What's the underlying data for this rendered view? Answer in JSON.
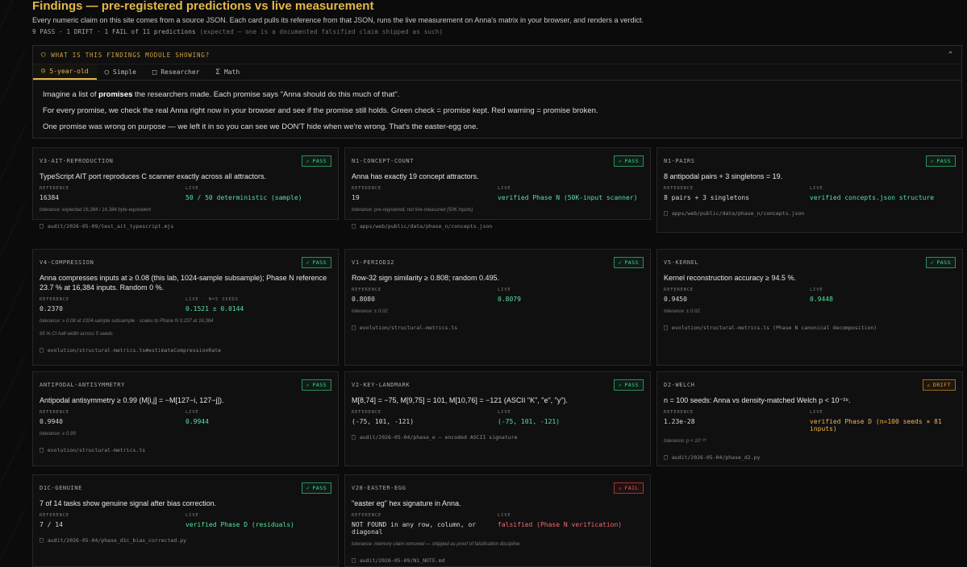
{
  "header": {
    "title": "Findings — pre-registered predictions vs live measurement",
    "subtitle": "Every numeric claim on this site comes from a source JSON. Each card pulls its reference from that JSON, runs the live measurement on Anna's matrix in your browser, and renders a verdict.",
    "stats": "9 PASS · 1 DRIFT · 1 FAIL of 11 predictions",
    "stats_note": "(expected — one is a documented falsified claim shipped as such)"
  },
  "explainer": {
    "heading": "WHAT IS THIS FINDINGS MODULE SHOWING?",
    "tabs": [
      "5-year-old",
      "Simple",
      "Researcher",
      "Math"
    ],
    "active_tab": "5-year-old",
    "p1_a": "Imagine a list of ",
    "p1_b": "promises",
    "p1_c": " the researchers made. Each promise says \"Anna should do this much of that\".",
    "p2": "For every promise, we check the real Anna right now in your browser and see if the promise still holds. Green check = promise kept. Red warning = promise broken.",
    "p3": "One promise was wrong on purpose — we left it in so you can see we DON'T hide when we're wrong. That's the easter-egg one."
  },
  "labels": {
    "reference": "REFERENCE",
    "live": "LIVE"
  },
  "cards": [
    {
      "id": "V3-AIT-REPRODUCTION",
      "status": "PASS",
      "claim": "TypeScript AIT port reproduces C scanner exactly across all attractors.",
      "reference": "16384",
      "live_label": "LIVE",
      "live": "50 / 50 deterministic (sample)",
      "notes": [
        "tolerance: expected 16,384 / 16,384 byte-equivalent"
      ],
      "source": "audit/2026-05-09/test_ait_typescript.mjs"
    },
    {
      "id": "N1-CONCEPT-COUNT",
      "status": "PASS",
      "claim": "Anna has exactly 19 concept attractors.",
      "reference": "19",
      "live_label": "LIVE",
      "live": "verified Phase N (50K-input scanner)",
      "notes": [
        "tolerance: pre-registered, not live-measured (50K inputs)"
      ],
      "source": "apps/web/public/data/phase_n/concepts.json"
    },
    {
      "id": "N1-PAIRS",
      "status": "PASS",
      "claim": "8 antipodal pairs + 3 singletons = 19.",
      "reference": "8 pairs + 3 singletons",
      "live_label": "LIVE",
      "live": "verified concepts.json structure",
      "notes": [],
      "source": "apps/web/public/data/phase_n/concepts.json"
    },
    {
      "id": "V4-COMPRESSION",
      "status": "PASS",
      "claim": "Anna compresses inputs at ≥ 0.08 (this lab, 1024-sample subsample); Phase N reference 23.7 % at 16,384 inputs. Random 0 %.",
      "reference": "0.2370",
      "live_label": "LIVE · N=5 SEEDS",
      "live": "0.1521 ± 0.0144",
      "notes": [
        "tolerance: ≥ 0.08 at 1024-sample subsample · scales to Phase N 0.237 at 16,384",
        "95 % CI half-width across 5 seeds"
      ],
      "source": "evolution/structural-metrics.ts#estimateCompressionRate"
    },
    {
      "id": "V1-PERIOD32",
      "status": "PASS",
      "claim": "Row-32 sign similarity ≥ 0.808; random 0.495.",
      "reference": "0.8080",
      "live_label": "LIVE",
      "live": "0.8079",
      "notes": [
        "tolerance: ± 0.02"
      ],
      "source": "evolution/structural-metrics.ts"
    },
    {
      "id": "V5-KERNEL",
      "status": "PASS",
      "claim": "Kernel reconstruction accuracy ≥ 94.5 %.",
      "reference": "0.9450",
      "live_label": "LIVE",
      "live": "0.9448",
      "notes": [
        "tolerance: ± 0.02"
      ],
      "source": "evolution/structural-metrics.ts (Phase N canonical decomposition)"
    },
    {
      "id": "ANTIPODAL-ANTISYMMETRY",
      "status": "PASS",
      "claim": "Antipodal antisymmetry ≥ 0.99 (M[i,j] = −M[127−i, 127−j]).",
      "reference": "0.9940",
      "live_label": "LIVE",
      "live": "0.9944",
      "notes": [
        "tolerance: ≥ 0.99"
      ],
      "source": "evolution/structural-metrics.ts"
    },
    {
      "id": "V2-KEY-LANDMARK",
      "status": "PASS",
      "claim": "M[8,74] = −75, M[9,75] = 101, M[10,76] = −121 (ASCII \"K\", \"e\", \"y\").",
      "reference": "(-75, 101, -121)",
      "live_label": "LIVE",
      "live": "(-75, 101, -121)",
      "notes": [],
      "source": "audit/2026-05-04/phase_e — encoded ASCII signature"
    },
    {
      "id": "D2-WELCH",
      "status": "DRIFT",
      "claim": "n = 100 seeds: Anna vs density-matched Welch p < 10⁻²⁸.",
      "reference": "1.23e-28",
      "live_label": "LIVE",
      "live": "verified Phase D (n=100 seeds × 81 inputs)",
      "notes": [
        "tolerance: p < 10⁻²⁸"
      ],
      "source": "audit/2026-05-04/phase_d2.py"
    },
    {
      "id": "D1C-GENUINE",
      "status": "PASS",
      "claim": "7 of 14 tasks show genuine signal after bias correction.",
      "reference": "7 / 14",
      "live_label": "LIVE",
      "live": "verified Phase D (residuals)",
      "notes": [],
      "source": "audit/2026-05-04/phase_d1c_bias_corrected.py"
    },
    {
      "id": "V28-EASTER-EGG",
      "status": "FAIL",
      "claim": "\"easter eg\" hex signature in Anna.",
      "reference": "NOT FOUND in any row, column, or diagonal",
      "live_label": "LIVE",
      "live": "falsified (Phase N verification)",
      "notes": [
        "tolerance: memory claim removed — shipped as proof of falsification discipline"
      ],
      "source": "audit/2026-05-09/N1_NOTE.md"
    }
  ],
  "colors": {
    "accent": "#e4b84c",
    "pass": "#43d18b",
    "drift": "#e6a340",
    "fail": "#ef5959"
  },
  "icons": {
    "explainer": "lightbulb-icon",
    "collapse": "chevron-up-icon",
    "source": "file-icon",
    "pass": "check-circle-icon",
    "drift": "warning-triangle-icon",
    "fail": "warning-triangle-icon"
  }
}
